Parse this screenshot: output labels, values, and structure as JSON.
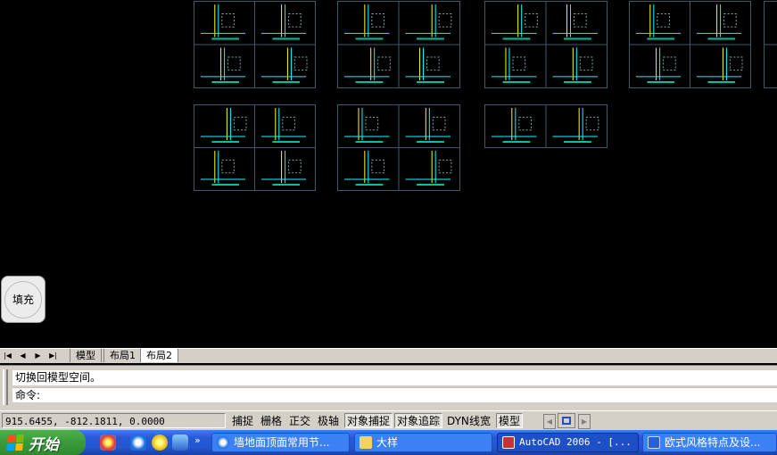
{
  "canvas": {
    "fill_button_label": "填充",
    "line_color": "#00ffff",
    "accent_color": "#ffff00",
    "sheet_border_color": "#3a5a6a"
  },
  "layout_tabs": {
    "nav_icons": [
      "first-tab-icon",
      "prev-tab-icon",
      "next-tab-icon",
      "last-tab-icon"
    ],
    "tabs": [
      {
        "label": "模型",
        "active": false
      },
      {
        "label": "布局1",
        "active": false
      },
      {
        "label": "布局2",
        "active": true
      }
    ]
  },
  "command": {
    "history": "切换回模型空间。",
    "prompt": "命令:"
  },
  "status": {
    "coords": "915.6455, -812.1811, 0.0000",
    "toggles": [
      {
        "label": "捕捉",
        "on": false
      },
      {
        "label": "栅格",
        "on": false
      },
      {
        "label": "正交",
        "on": false
      },
      {
        "label": "极轴",
        "on": false
      },
      {
        "label": "对象捕捉",
        "on": true
      },
      {
        "label": "对象追踪",
        "on": true
      },
      {
        "label": "DYN",
        "on": false
      },
      {
        "label": "线宽",
        "on": false
      },
      {
        "label": "模型",
        "on": true
      }
    ]
  },
  "taskbar": {
    "start_label": "开始",
    "tasks": [
      {
        "label": "墙地面顶面常用节...",
        "icon": "ie-icon",
        "active": false
      },
      {
        "label": "大样",
        "icon": "folder-icon",
        "active": false
      },
      {
        "label": "AutoCAD 2006 - [...",
        "icon": "autocad-icon",
        "active": true
      },
      {
        "label": "欧式风格特点及设...",
        "icon": "word-icon",
        "active": false
      }
    ]
  }
}
